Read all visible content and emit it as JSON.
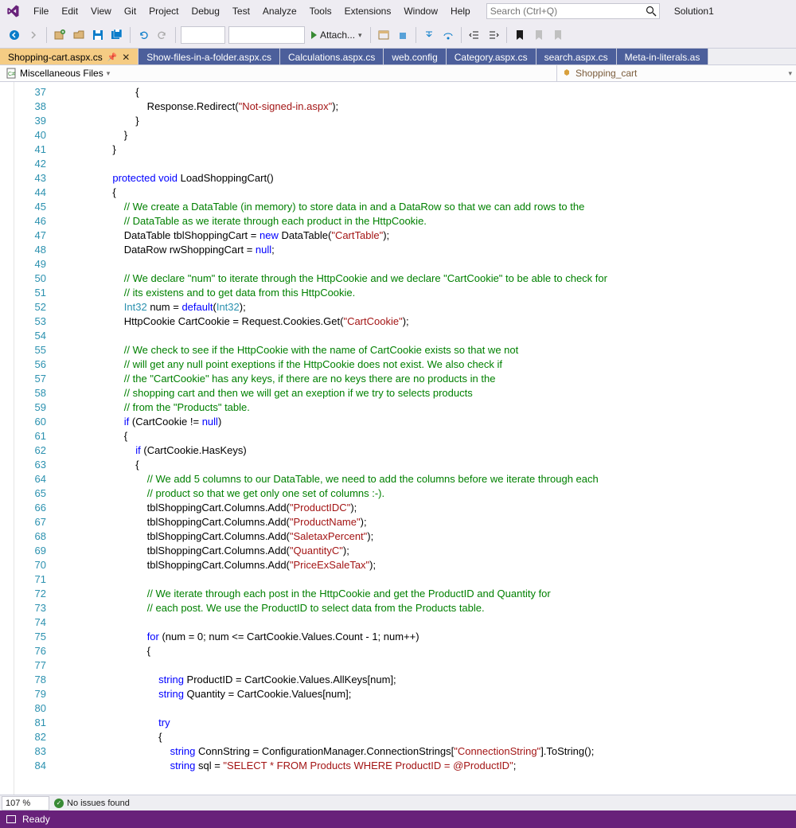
{
  "menu": [
    "File",
    "Edit",
    "View",
    "Git",
    "Project",
    "Debug",
    "Test",
    "Analyze",
    "Tools",
    "Extensions",
    "Window",
    "Help"
  ],
  "search_placeholder": "Search (Ctrl+Q)",
  "solution": "Solution1",
  "attach_label": "Attach...",
  "tabs": [
    {
      "label": "Shopping-cart.aspx.cs",
      "active": true,
      "pinned": true
    },
    {
      "label": "Show-files-in-a-folder.aspx.cs",
      "active": false
    },
    {
      "label": "Calculations.aspx.cs",
      "active": false
    },
    {
      "label": "web.config",
      "active": false
    },
    {
      "label": "Category.aspx.cs",
      "active": false
    },
    {
      "label": "search.aspx.cs",
      "active": false
    },
    {
      "label": "Meta-in-literals.as",
      "active": false
    }
  ],
  "nav_left": "Miscellaneous Files",
  "nav_right": "Shopping_cart",
  "line_start": 37,
  "line_end": 84,
  "zoom": "107 %",
  "issues": "No issues found",
  "status": "Ready",
  "code_lines": [
    "                    {",
    "                        Response.Redirect(§\"Not-signed-in.aspx\"§);",
    "                    }",
    "                }",
    "            }",
    "",
    "            ~protected~ ~void~ LoadShoppingCart()",
    "            {",
    "                ¢// We create a DataTable (in memory) to store data in and a DataRow so that we can add rows to the¢",
    "                ¢// DataTable as we iterate through each product in the HttpCookie.¢",
    "                DataTable tblShoppingCart = ~new~ DataTable(§\"CartTable\"§);",
    "                DataRow rwShoppingCart = ~null~;",
    "",
    "                ¢// We declare \"num\" to iterate through the HttpCookie and we declare \"CartCookie\" to be able to check for¢",
    "                ¢// its existens and to get data from this HttpCookie.¢",
    "                ¤Int32¤ num = ~default~(¤Int32¤);",
    "                HttpCookie CartCookie = Request.Cookies.Get(§\"CartCookie\"§);",
    "",
    "                ¢// We check to see if the HttpCookie with the name of CartCookie exists so that we not¢",
    "                ¢// will get any null point exeptions if the HttpCookie does not exist. We also check if¢",
    "                ¢// the \"CartCookie\" has any keys, if there are no keys there are no products in the¢",
    "                ¢// shopping cart and then we will get an exeption if we try to selects products¢",
    "                ¢// from the \"Products\" table.¢",
    "                ~if~ (CartCookie != ~null~)",
    "                {",
    "                    ~if~ (CartCookie.HasKeys)",
    "                    {",
    "                        ¢// We add 5 columns to our DataTable, we need to add the columns before we iterate through each¢",
    "                        ¢// product so that we get only one set of columns :-).¢",
    "                        tblShoppingCart.Columns.Add(§\"ProductIDC\"§);",
    "                        tblShoppingCart.Columns.Add(§\"ProductName\"§);",
    "                        tblShoppingCart.Columns.Add(§\"SaletaxPercent\"§);",
    "                        tblShoppingCart.Columns.Add(§\"QuantityC\"§);",
    "                        tblShoppingCart.Columns.Add(§\"PriceExSaleTax\"§);",
    "",
    "                        ¢// We iterate through each post in the HttpCookie and get the ProductID and Quantity for¢",
    "                        ¢// each post. We use the ProductID to select data from the Products table.¢",
    "",
    "                        ~for~ (num = 0; num <= CartCookie.Values.Count - 1; num++)",
    "                        {",
    "",
    "                            ~string~ ProductID = CartCookie.Values.AllKeys[num];",
    "                            ~string~ Quantity = CartCookie.Values[num];",
    "",
    "                            ~try~",
    "                            {",
    "                                ~string~ ConnString = ConfigurationManager.ConnectionStrings[§\"ConnectionString\"§].ToString();",
    "                                ~string~ sql = §\"SELECT * FROM Products WHERE ProductID = @ProductID\"§;"
  ]
}
